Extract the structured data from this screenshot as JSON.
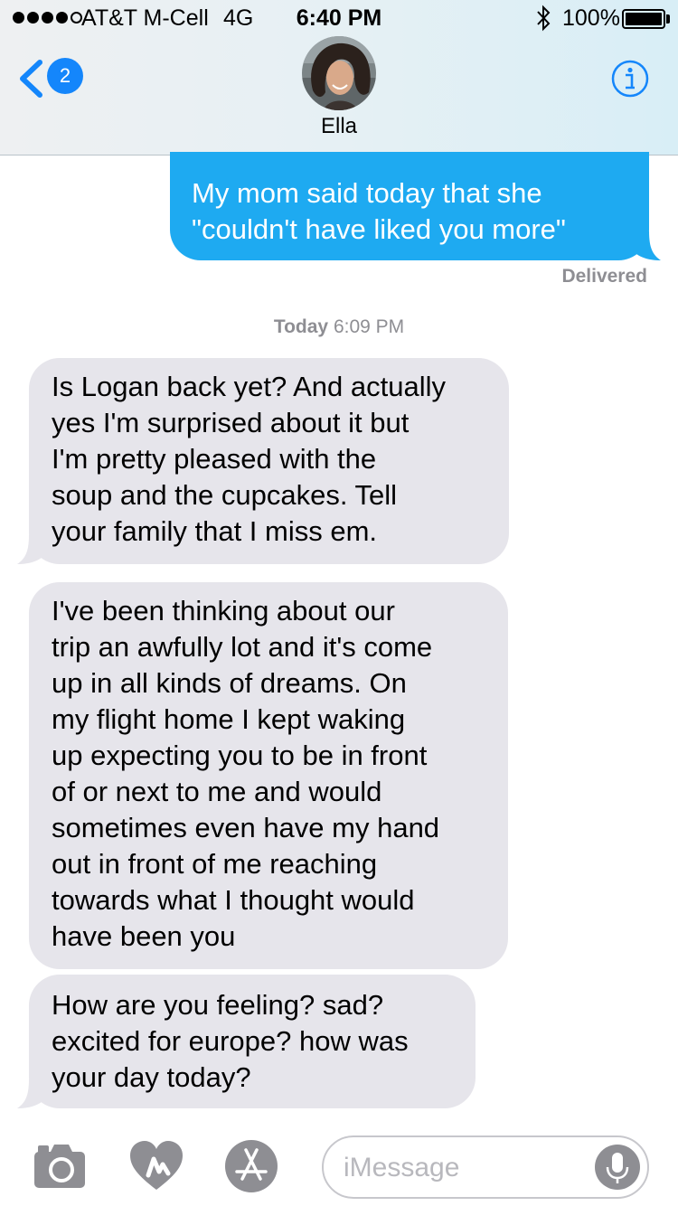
{
  "status_bar": {
    "carrier": "AT&T M-Cell",
    "network": "4G",
    "time": "6:40 PM",
    "battery_percent": "100%"
  },
  "nav": {
    "back_badge": "2",
    "contact_name": "Ella"
  },
  "messages": {
    "sent_0": [
      "My mom said today that she",
      "\"couldn't have liked you more\""
    ],
    "delivered_label": "Delivered",
    "timestamp_day": "Today",
    "timestamp_time": "6:09 PM",
    "received_0": [
      "Is Logan back yet? And actually",
      "yes I'm surprised about it but",
      "I'm pretty pleased with the",
      "soup and the cupcakes. Tell",
      "your family that I miss em."
    ],
    "received_1": [
      "I've been thinking about our",
      "trip an awfully lot and it's come",
      "up in all kinds of dreams. On",
      "my flight home I kept waking",
      "up expecting you to be in front",
      "of or next to me and would",
      "sometimes even have my hand",
      "out in front of me reaching",
      "towards what I thought would",
      "have been you"
    ],
    "received_2": [
      "How are you feeling? sad?",
      "excited for europe? how was",
      "your day today?"
    ]
  },
  "input_bar": {
    "placeholder": "iMessage"
  },
  "colors": {
    "ios_blue": "#1486fb",
    "sent_bubble": "#1eaaf1",
    "received_bubble": "#e6e5eb",
    "secondary_text": "#8e8e93"
  },
  "icons": [
    "signal-icon",
    "bluetooth-icon",
    "battery-icon",
    "back-chevron-icon",
    "info-icon",
    "camera-icon",
    "digital-touch-icon",
    "app-store-icon",
    "microphone-icon"
  ]
}
